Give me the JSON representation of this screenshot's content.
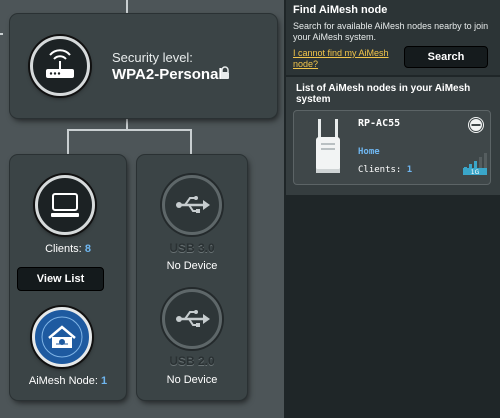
{
  "router": {
    "security_title": "Security level:",
    "security_value": "WPA2-Personal",
    "icons": [
      "router-icon",
      "lock-icon"
    ]
  },
  "clients": {
    "label": "Clients:",
    "count": "8",
    "view_list": "View List",
    "icon": "monitor-icon"
  },
  "aimesh": {
    "label": "AiMesh Node:",
    "count": "1",
    "icon": "aimesh-house-icon"
  },
  "usb": [
    {
      "label": "USB 3.0",
      "status": "No Device",
      "icon": "usb-icon"
    },
    {
      "label": "USB 2.0",
      "status": "No Device",
      "icon": "usb-icon"
    }
  ],
  "find": {
    "title": "Find AiMesh node",
    "description": "Search for available AiMesh nodes nearby to join your AiMesh system.",
    "help_link": "I cannot find my AiMesh node?",
    "search_label": "Search"
  },
  "node_list": {
    "title": "List of AiMesh nodes in your AiMesh system",
    "nodes": [
      {
        "name": "RP-AC55",
        "location": "Home",
        "clients_label": "Clients:",
        "clients_count": "1",
        "signal_text": "1G"
      }
    ]
  },
  "colors": {
    "accent": "#6fb6f0",
    "link": "#f3c54a",
    "panel": "#4d5558",
    "card": "#3b4446"
  }
}
